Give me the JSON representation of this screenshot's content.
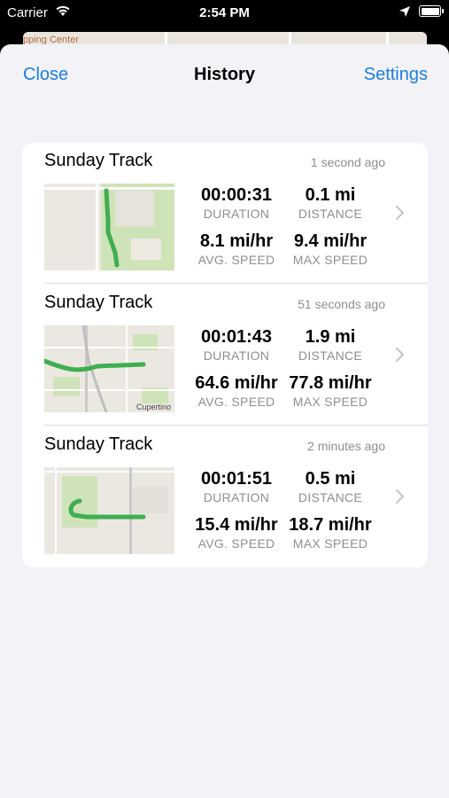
{
  "status_bar": {
    "carrier": "Carrier",
    "time": "2:54 PM"
  },
  "background": {
    "peek_label": "pping Center"
  },
  "nav": {
    "close_label": "Close",
    "title": "History",
    "settings_label": "Settings"
  },
  "colors": {
    "accent": "#1a7fe0",
    "track": "#3fae4f"
  },
  "tracks": [
    {
      "name": "Sunday Track",
      "ago": "1 second ago",
      "duration": "00:00:31",
      "duration_label": "DURATION",
      "distance": "0.1 mi",
      "distance_label": "DISTANCE",
      "avg_speed": "8.1 mi/hr",
      "avg_speed_label": "AVG. SPEED",
      "max_speed": "9.4 mi/hr",
      "max_speed_label": "MAX SPEED",
      "thumb_icon": "map-thumbnail"
    },
    {
      "name": "Sunday Track",
      "ago": "51 seconds ago",
      "duration": "00:01:43",
      "duration_label": "DURATION",
      "distance": "1.9 mi",
      "distance_label": "DISTANCE",
      "avg_speed": "64.6 mi/hr",
      "avg_speed_label": "AVG. SPEED",
      "max_speed": "77.8 mi/hr",
      "max_speed_label": "MAX SPEED",
      "thumb_icon": "map-thumbnail",
      "map_label": "Cupertino"
    },
    {
      "name": "Sunday Track",
      "ago": "2 minutes ago",
      "duration": "00:01:51",
      "duration_label": "DURATION",
      "distance": "0.5 mi",
      "distance_label": "DISTANCE",
      "avg_speed": "15.4 mi/hr",
      "avg_speed_label": "AVG. SPEED",
      "max_speed": "18.7 mi/hr",
      "max_speed_label": "MAX SPEED",
      "thumb_icon": "map-thumbnail"
    }
  ]
}
